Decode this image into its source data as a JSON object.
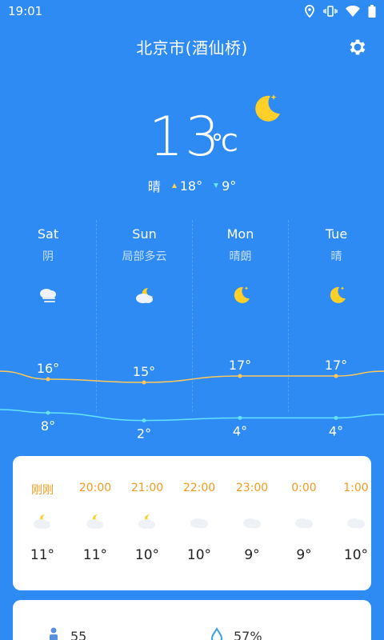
{
  "status": {
    "time": "19:01"
  },
  "header": {
    "city": "北京市(酒仙桥)"
  },
  "current": {
    "temp": "13",
    "unit": "℃",
    "condition": "晴",
    "high": "18°",
    "low": "9°"
  },
  "forecast": [
    {
      "day": "Sat",
      "desc": "阴",
      "icon": "cloud-fog-icon",
      "high": "16°",
      "low": "8°",
      "high_val": 16,
      "low_val": 8
    },
    {
      "day": "Sun",
      "desc": "局部多云",
      "icon": "partly-cloudy-night-icon",
      "high": "15°",
      "low": "2°",
      "high_val": 15,
      "low_val": 2
    },
    {
      "day": "Mon",
      "desc": "晴朗",
      "icon": "moon-icon",
      "high": "17°",
      "low": "4°",
      "high_val": 17,
      "low_val": 4
    },
    {
      "day": "Tue",
      "desc": "晴",
      "icon": "moon-icon",
      "high": "17°",
      "low": "4°",
      "high_val": 17,
      "low_val": 4
    }
  ],
  "hourly": [
    {
      "time": "刚刚",
      "icon": "partly-cloudy-night-icon",
      "temp": "11°"
    },
    {
      "time": "20:00",
      "icon": "partly-cloudy-night-icon",
      "temp": "11°"
    },
    {
      "time": "21:00",
      "icon": "partly-cloudy-night-icon",
      "temp": "10°"
    },
    {
      "time": "22:00",
      "icon": "cloud-icon",
      "temp": "10°"
    },
    {
      "time": "23:00",
      "icon": "cloud-icon",
      "temp": "9°"
    },
    {
      "time": "0:00",
      "icon": "cloud-icon",
      "temp": "9°"
    },
    {
      "time": "1:00",
      "icon": "cloud-icon",
      "temp": "10°"
    }
  ],
  "stats": {
    "aqi": "55",
    "aqi_icon": "person-icon",
    "humidity": "57%",
    "humidity_icon": "water-drop-icon"
  },
  "colors": {
    "background": "#2f8bf4",
    "high_curve": "#ffc85a",
    "low_curve": "#63e3ff",
    "moon": "#ffcf2a",
    "hour_label": "#f39a1e"
  }
}
